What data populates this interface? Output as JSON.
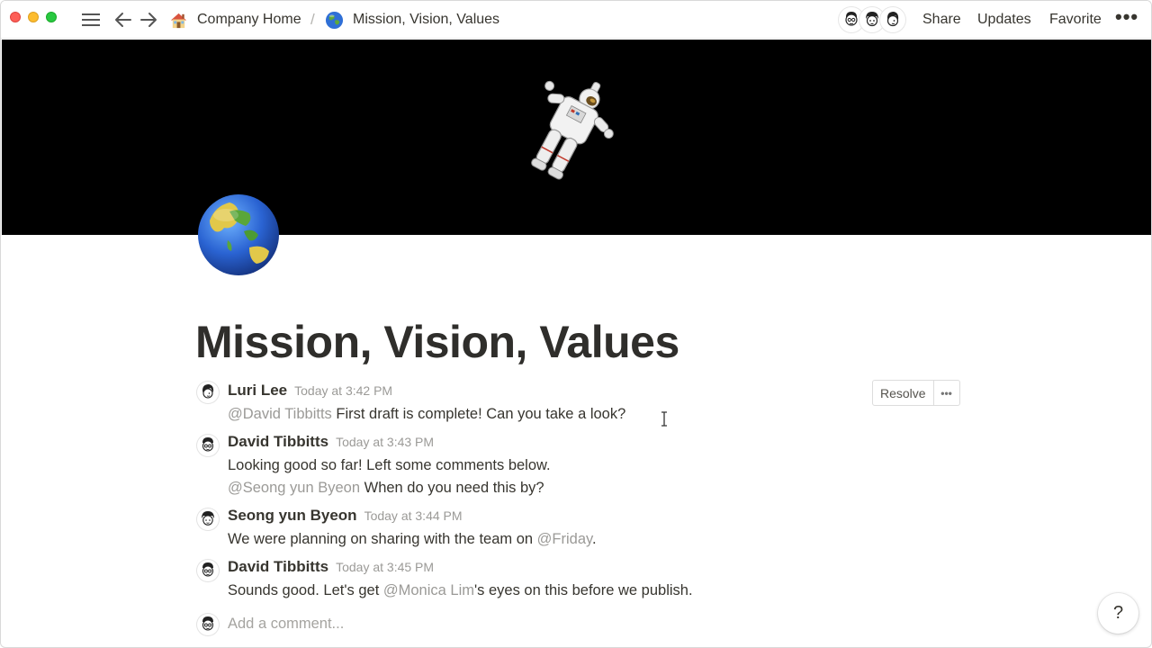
{
  "window": {
    "controls": [
      "close",
      "minimize",
      "zoom"
    ]
  },
  "breadcrumb": {
    "home_label": "Company Home",
    "home_icon": "house-emoji-icon",
    "separator": "/",
    "page_label": "Mission, Vision, Values",
    "page_icon": "globe-emoji-icon"
  },
  "topbar": {
    "share_label": "Share",
    "updates_label": "Updates",
    "favorite_label": "Favorite",
    "more_label": "•••"
  },
  "page": {
    "title": "Mission, Vision, Values",
    "cover": "astronaut-on-black",
    "icon": "globe-emoji-icon"
  },
  "comments": [
    {
      "author": "Luri Lee",
      "time": "Today at 3:42 PM",
      "lines": [
        {
          "mention": "@David Tibbitts",
          "text": " First draft is complete! Can you take a look?"
        }
      ]
    },
    {
      "author": "David Tibbitts",
      "time": "Today at 3:43 PM",
      "lines": [
        {
          "mention": "",
          "text": "Looking good so far! Left some comments below."
        },
        {
          "mention": "@Seong yun Byeon",
          "text": " When do you need this by?"
        }
      ]
    },
    {
      "author": "Seong yun Byeon",
      "time": "Today at 3:44 PM",
      "lines": [
        {
          "before": "We were planning on sharing with the team on ",
          "mention": "@Friday",
          "after": "."
        }
      ]
    },
    {
      "author": "David Tibbitts",
      "time": "Today at 3:45 PM",
      "lines": [
        {
          "before": "Sounds good. Let's get ",
          "mention": "@Monica Lim",
          "after": "'s eyes on this before we publish."
        }
      ]
    }
  ],
  "comment_actions": {
    "resolve_label": "Resolve",
    "more_label": "•••"
  },
  "add_comment": {
    "placeholder": "Add a comment..."
  },
  "help": {
    "label": "?"
  },
  "colors": {
    "text": "#37352f",
    "muted": "#9b9a97",
    "cover": "#000000"
  }
}
